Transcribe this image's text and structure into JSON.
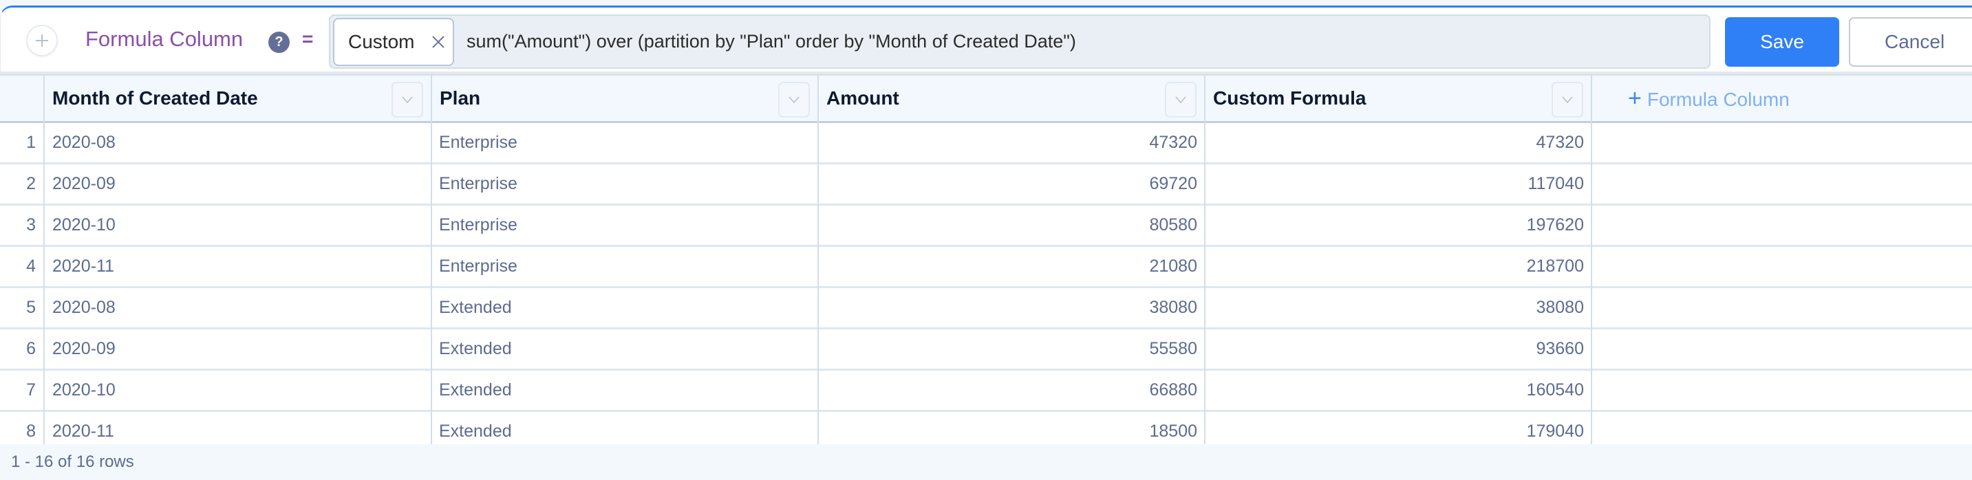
{
  "formula_bar": {
    "add_icon": "plus-circle-icon",
    "label": "Formula Column",
    "help_icon": "question-mark-icon",
    "equals": "=",
    "chip_label": "Custom",
    "chip_close_icon": "close-x-icon",
    "formula": "sum(\"Amount\") over (partition by \"Plan\" order by \"Month of Created Date\")",
    "save_label": "Save",
    "cancel_label": "Cancel"
  },
  "table": {
    "columns": [
      {
        "label": "Month of Created Date",
        "dropdown_icon": "chevron-down-icon"
      },
      {
        "label": "Plan",
        "dropdown_icon": "chevron-down-icon"
      },
      {
        "label": "Amount",
        "dropdown_icon": "chevron-down-icon"
      },
      {
        "label": "Custom Formula",
        "dropdown_icon": "chevron-down-icon"
      }
    ],
    "add_column_plus": "+",
    "add_column_label": "Formula Column",
    "rows": [
      {
        "n": "1",
        "month": "2020-08",
        "plan": "Enterprise",
        "amount": "47320",
        "custom": "47320"
      },
      {
        "n": "2",
        "month": "2020-09",
        "plan": "Enterprise",
        "amount": "69720",
        "custom": "117040"
      },
      {
        "n": "3",
        "month": "2020-10",
        "plan": "Enterprise",
        "amount": "80580",
        "custom": "197620"
      },
      {
        "n": "4",
        "month": "2020-11",
        "plan": "Enterprise",
        "amount": "21080",
        "custom": "218700"
      },
      {
        "n": "5",
        "month": "2020-08",
        "plan": "Extended",
        "amount": "38080",
        "custom": "38080"
      },
      {
        "n": "6",
        "month": "2020-09",
        "plan": "Extended",
        "amount": "55580",
        "custom": "93660"
      },
      {
        "n": "7",
        "month": "2020-10",
        "plan": "Extended",
        "amount": "66880",
        "custom": "160540"
      },
      {
        "n": "8",
        "month": "2020-11",
        "plan": "Extended",
        "amount": "18500",
        "custom": "179040"
      }
    ]
  },
  "footer": {
    "row_count": "1 - 16 of 16 rows"
  },
  "colors": {
    "accent": "#2f80f7",
    "label_purple": "#8b4fa8",
    "cell_text": "#5d6b8f",
    "header_bg": "#f2f8fd"
  }
}
